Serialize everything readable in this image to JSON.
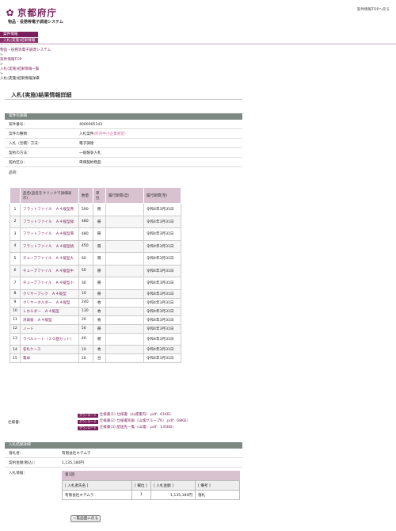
{
  "header": {
    "logo_text": "京都府庁",
    "system_name": "物品・役務等電子調達システム",
    "top_link": "案件情報TOPへ戻る"
  },
  "menu": {
    "items": [
      "案件情報",
      "入札(実施)結果情報"
    ]
  },
  "breadcrumb": {
    "items": [
      "物品・役務等電子調達システム",
      "案件情報TOP",
      "入札(実施)結果情報一覧",
      "入札(実施)結果情報詳細"
    ],
    "sep": ">"
  },
  "page_title": "入札(実施)結果情報詳細",
  "details": {
    "section": "案件の詳細",
    "rows": [
      {
        "label": "案件番号：",
        "value": "4000005143"
      },
      {
        "label": "案件の種類：",
        "value": "入札案件",
        "extra": "(府内中小企業限定)"
      },
      {
        "label": "入札（見積）方法：",
        "value": "電子調達"
      },
      {
        "label": "契約の方法：",
        "value": "一般競争入札"
      },
      {
        "label": "契約区分：",
        "value": "単価契約物品"
      },
      {
        "label": "品目：",
        "value": ""
      }
    ]
  },
  "items_table": {
    "headers": [
      "",
      "品名(品名をクリックで詳細表示)",
      "数量",
      "単位",
      "履行期間(自)",
      "履行期間(至)"
    ],
    "rows": [
      {
        "no": "1",
        "name": "フラットファイル　Ａ４縦型青",
        "qty": "500",
        "unit": "冊",
        "from": "",
        "to": "令和4年3月31日"
      },
      {
        "no": "2",
        "name": "フラットファイル　Ａ４縦型緑",
        "qty": "480",
        "unit": "冊",
        "from": "",
        "to": "令和4年3月31日"
      },
      {
        "no": "3",
        "name": "フラットファイル　Ａ４縦型黄",
        "qty": "480",
        "unit": "冊",
        "from": "",
        "to": "令和4年3月31日"
      },
      {
        "no": "4",
        "name": "フラットファイル　Ａ４縦型桃",
        "qty": "450",
        "unit": "冊",
        "from": "",
        "to": "令和4年3月31日"
      },
      {
        "no": "5",
        "name": "チューブファイル　Ａ４縦型大",
        "qty": "60",
        "unit": "冊",
        "from": "",
        "to": "令和4年3月31日"
      },
      {
        "no": "6",
        "name": "チューブファイル　Ａ４縦型中",
        "qty": "50",
        "unit": "冊",
        "from": "",
        "to": "令和4年3月31日"
      },
      {
        "no": "7",
        "name": "チューブファイル　Ａ４縦型小",
        "qty": "30",
        "unit": "冊",
        "from": "",
        "to": "令和4年3月31日"
      },
      {
        "no": "8",
        "name": "クリヤーブック　Ａ４縦型",
        "qty": "10",
        "unit": "冊",
        "from": "",
        "to": "令和4年3月31日"
      },
      {
        "no": "9",
        "name": "クリヤーホルダー　Ａ４縦型",
        "qty": "240",
        "unit": "枚",
        "from": "",
        "to": "令和4年3月31日"
      },
      {
        "no": "10",
        "name": "Ｌホルダー　Ａ４縦型",
        "qty": "130",
        "unit": "枚",
        "from": "",
        "to": "令和4年3月31日"
      },
      {
        "no": "11",
        "name": "決裁板　Ａ４縦型",
        "qty": "20",
        "unit": "枚",
        "from": "",
        "to": "令和4年3月31日"
      },
      {
        "no": "12",
        "name": "ノート",
        "qty": "50",
        "unit": "冊",
        "from": "",
        "to": "令和4年3月31日"
      },
      {
        "no": "13",
        "name": "ラベルシート（２０面カット）",
        "qty": "40",
        "unit": "冊",
        "from": "",
        "to": "令和4年3月31日"
      },
      {
        "no": "14",
        "name": "名札ケース",
        "qty": "10",
        "unit": "枚",
        "from": "",
        "to": "令和4年3月31日"
      },
      {
        "no": "15",
        "name": "電卓",
        "qty": "20",
        "unit": "台",
        "from": "",
        "to": "令和4年3月31日"
      }
    ]
  },
  "specs": {
    "label": "仕様書：",
    "badge": "ダウンロード",
    "files": [
      "仕様書(1) 仕様書（山城電内）.pdf：61KB）",
      "仕様書(2) 仕様書別表（山城グループ6）.pdf：68KB）",
      "仕様書(3) 配送先一覧（山城）.pdf：135KB）"
    ]
  },
  "results": {
    "section": "入札結果詳細",
    "winner_label": "落札者：",
    "winner": "有限会社キテムラ",
    "amount_label": "契約金額(税込)：",
    "amount": "1,135,180円",
    "info_label": "入札情報：",
    "round": "第1回",
    "headers": [
      "[ 入札者氏名 ]",
      "[ 欄位 ]",
      "[ 入札金額 ]",
      "[ 備考 ]"
    ],
    "row": [
      "有限会社キテムラ",
      "1",
      "1,135,180円",
      "落札"
    ]
  },
  "back_button": "一覧画面に戻る"
}
